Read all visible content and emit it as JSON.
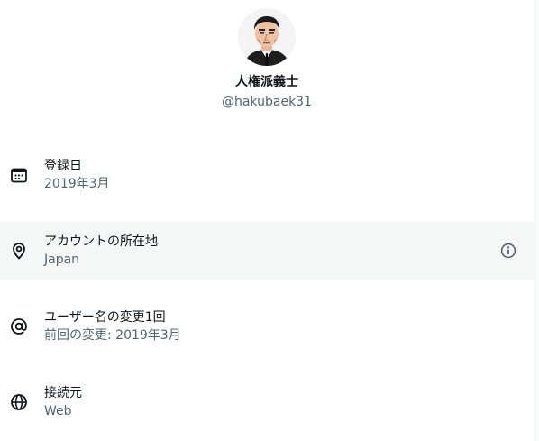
{
  "profile": {
    "display_name": "人権派義士",
    "handle": "@hakubaek31"
  },
  "rows": [
    {
      "icon": "calendar-icon",
      "label": "登録日",
      "value": "2019年3月"
    },
    {
      "icon": "location-pin-icon",
      "label": "アカウントの所在地",
      "value": "Japan"
    },
    {
      "icon": "at-sign-icon",
      "label": "ユーザー名の変更1回",
      "value": "前回の変更: 2019年3月"
    },
    {
      "icon": "globe-icon",
      "label": "接続元",
      "value": "Web"
    }
  ],
  "colors": {
    "text_primary": "#0f1419",
    "text_secondary": "#536471",
    "row_highlight": "#f5f7f7"
  }
}
